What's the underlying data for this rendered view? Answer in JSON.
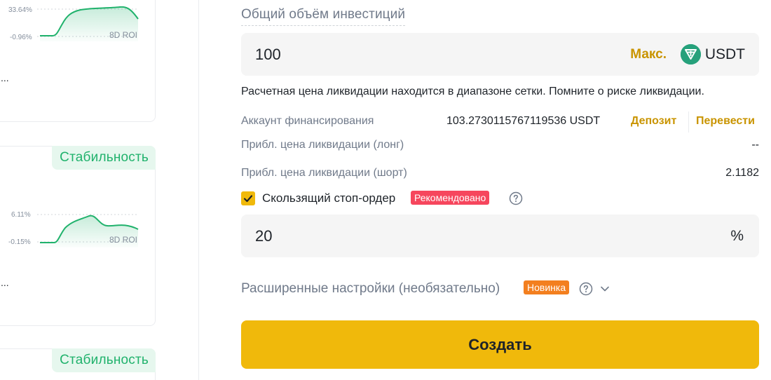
{
  "left_cards": [
    {
      "chart_top_label": "33.64%",
      "chart_bottom_label": "-0.96%",
      "roi_label": "8D ROI",
      "ellipsis": "..."
    },
    {
      "badge": "Стабильность",
      "chart_top_label": "6.11%",
      "chart_bottom_label": "-0.15%",
      "roi_label": "8D ROI",
      "ellipsis": "..."
    },
    {
      "badge": "Стабильность"
    }
  ],
  "form": {
    "title": "Общий объём инвестиций",
    "amount_value": "100",
    "max_label": "Макс.",
    "coin": "USDT",
    "coin_icon": "tether-icon",
    "liquidation_note": "Расчетная цена ликвидации находится в диапазоне сетки. Помните о риске ликвидации.",
    "funding_label": "Аккаунт финансирования",
    "funding_value": "103.2730115767119536 USDT",
    "deposit_label": "Депозит",
    "transfer_label": "Перевести",
    "liq_long_label": "Прибл. цена ликвидации (лонг)",
    "liq_long_value": "--",
    "liq_short_label": "Прибл. цена ликвидации (шорт)",
    "liq_short_value": "2.1182",
    "trailing_label": "Скользящий стоп-ордер",
    "trailing_checked": true,
    "recommended_tag": "Рекомендовано",
    "percent_value": "20",
    "percent_sign": "%",
    "advanced_label": "Расширенные настройки (необязательно)",
    "new_tag": "Новинка",
    "create_label": "Создать"
  },
  "colors": {
    "accent": "#f0b90b",
    "link": "#c99400",
    "green": "#20b26c",
    "red_tag": "#f6465d",
    "orange_tag": "#f37f1f"
  }
}
